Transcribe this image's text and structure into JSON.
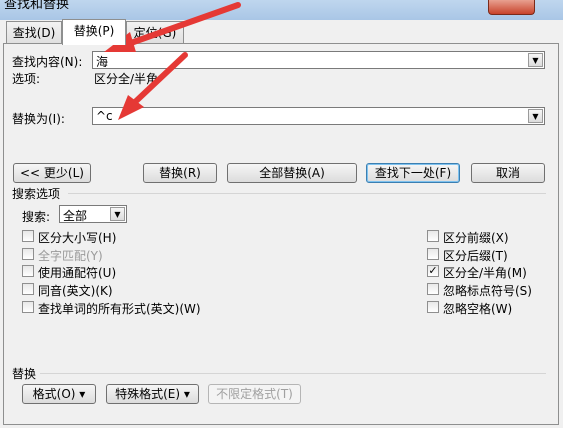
{
  "window": {
    "title": "查找和替换"
  },
  "tabs": [
    {
      "label": "查找(D)"
    },
    {
      "label": "替换(P)"
    },
    {
      "label": "定位(G)"
    }
  ],
  "find": {
    "label": "查找内容(N):",
    "value": "海"
  },
  "options_row": {
    "label": "选项:",
    "value": "区分全/半角"
  },
  "replace": {
    "label": "替换为(I):",
    "value": "^c"
  },
  "buttons": {
    "less": "<< 更少(L)",
    "replace": "替换(R)",
    "replace_all": "全部替换(A)",
    "find_next": "查找下一处(F)",
    "cancel": "取消"
  },
  "search_options": {
    "title": "搜索选项",
    "search_label": "搜索:",
    "search_value": "全部",
    "left": [
      {
        "label": "区分大小写(H)",
        "checked": false,
        "disabled": false
      },
      {
        "label": "全字匹配(Y)",
        "checked": false,
        "disabled": true
      },
      {
        "label": "使用通配符(U)",
        "checked": false,
        "disabled": false
      },
      {
        "label": "同音(英文)(K)",
        "checked": false,
        "disabled": false
      },
      {
        "label": "查找单词的所有形式(英文)(W)",
        "checked": false,
        "disabled": false
      }
    ],
    "right": [
      {
        "label": "区分前缀(X)",
        "checked": false,
        "disabled": false
      },
      {
        "label": "区分后缀(T)",
        "checked": false,
        "disabled": false
      },
      {
        "label": "区分全/半角(M)",
        "checked": true,
        "disabled": false
      },
      {
        "label": "忽略标点符号(S)",
        "checked": false,
        "disabled": false
      },
      {
        "label": "忽略空格(W)",
        "checked": false,
        "disabled": false
      }
    ]
  },
  "replace_section": {
    "title": "替换",
    "format": "格式(O) ▾",
    "special": "特殊格式(E) ▾",
    "no_format": "不限定格式(T)"
  },
  "colors": {
    "annotation_arrow": "#e53935"
  }
}
